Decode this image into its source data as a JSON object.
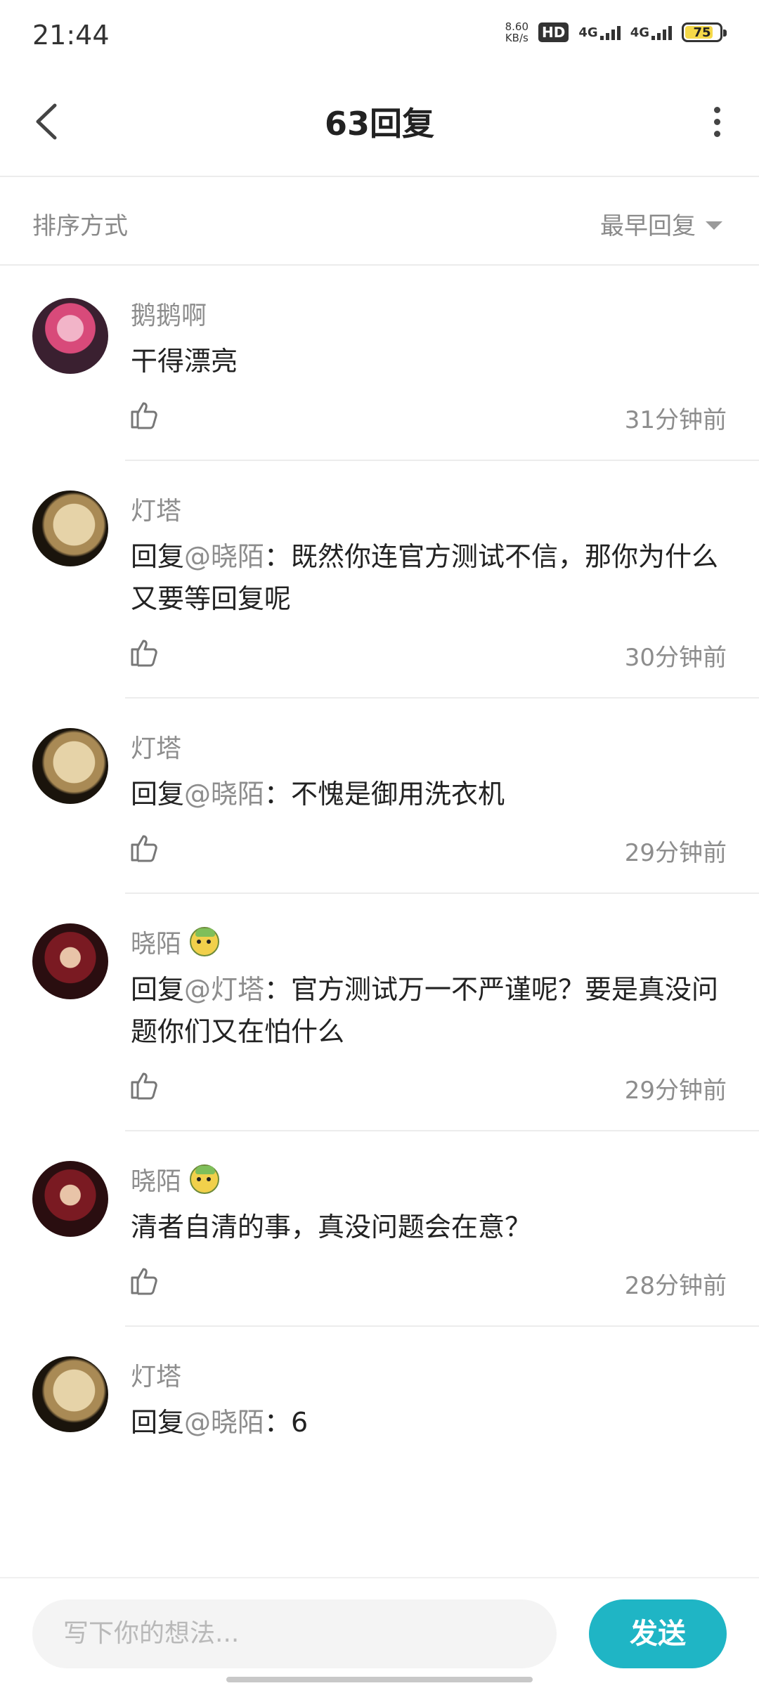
{
  "status_bar": {
    "time": "21:44",
    "net_speed_value": "8.60",
    "net_speed_unit": "KB/s",
    "hd_label": "HD",
    "sim1_label": "4G",
    "sim2_label": "4G",
    "battery": "75"
  },
  "header": {
    "title": "63回复",
    "back_icon": "chevron-left-icon",
    "more_icon": "more-vertical-icon"
  },
  "sort": {
    "label": "排序方式",
    "selected": "最早回复"
  },
  "comments": [
    {
      "name": "鹅鹅啊",
      "badge": false,
      "mention": "",
      "text": "干得漂亮",
      "time": "31分钟前"
    },
    {
      "name": "灯塔",
      "badge": false,
      "mention": "@晓陌",
      "text": "既然你连官方测试不信，那你为什么又要等回复呢",
      "time": "30分钟前"
    },
    {
      "name": "灯塔",
      "badge": false,
      "mention": "@晓陌",
      "text": "不愧是御用洗衣机",
      "time": "29分钟前"
    },
    {
      "name": "晓陌",
      "badge": true,
      "mention": "@灯塔",
      "text": "官方测试万一不严谨呢？要是真没问题你们又在怕什么",
      "time": "29分钟前"
    },
    {
      "name": "晓陌",
      "badge": true,
      "mention": "",
      "text": "清者自清的事，真没问题会在意？",
      "time": "28分钟前"
    },
    {
      "name": "灯塔",
      "badge": false,
      "mention": "@晓陌",
      "text": "6",
      "time": ""
    }
  ],
  "reply_prefix": "回复",
  "reply_colon": "：",
  "input": {
    "placeholder": "写下你的想法...",
    "send_label": "发送"
  },
  "colors": {
    "accent": "#1fb5c5",
    "secondary_text": "#8d8d8d"
  }
}
